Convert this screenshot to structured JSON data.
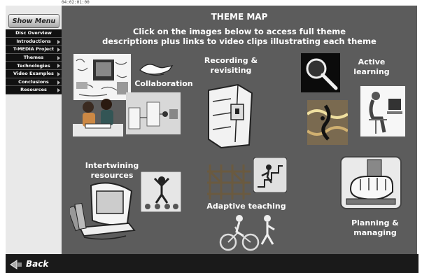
{
  "timecode": "04:02:01:00",
  "show_menu_label": "Show Menu",
  "menu": [
    {
      "label": "Disc Overview",
      "arrow": false
    },
    {
      "label": "Introductions",
      "arrow": true
    },
    {
      "label": "T-MEDIA Project",
      "arrow": true
    },
    {
      "label": "Themes",
      "arrow": true
    },
    {
      "label": "Technologies",
      "arrow": true
    },
    {
      "label": "Video Examples",
      "arrow": true
    },
    {
      "label": "Conclusions",
      "arrow": true
    },
    {
      "label": "Resources",
      "arrow": true
    }
  ],
  "title": "THEME MAP",
  "subtitle_line1": "Click on the images below to access full theme",
  "subtitle_line2": "descriptions plus links to video clips illustrating each theme",
  "themes": {
    "collaboration": "Collaboration",
    "recording_line1": "Recording &",
    "recording_line2": "revisiting",
    "active_line1": "Active",
    "active_line2": "learning",
    "intertwining_line1": "Intertwining",
    "intertwining_line2": "resources",
    "adaptive": "Adaptive teaching",
    "planning_line1": "Planning &",
    "planning_line2": "managing"
  },
  "back_label": "Back"
}
